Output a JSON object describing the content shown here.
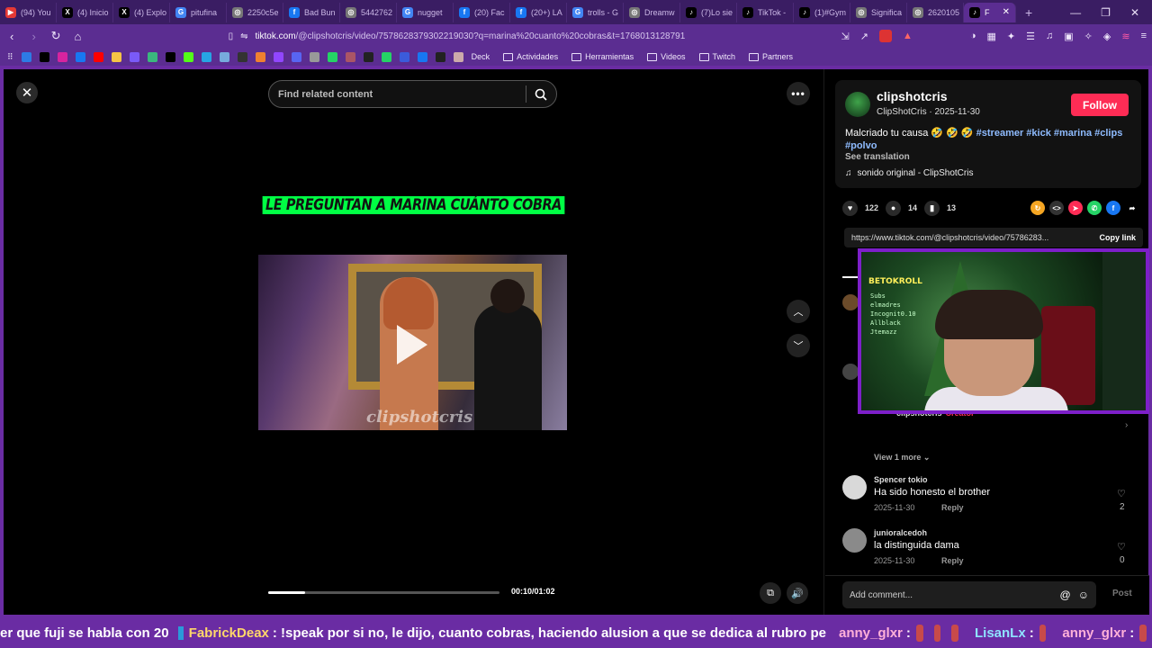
{
  "browser": {
    "tabs": [
      {
        "label": "(94) You",
        "color": "#e53935",
        "glyph": "▶"
      },
      {
        "label": "(4) Inicio",
        "color": "#000000",
        "glyph": "X"
      },
      {
        "label": "(4) Explo",
        "color": "#000000",
        "glyph": "X"
      },
      {
        "label": "pitufina",
        "color": "#4285f4",
        "glyph": "G"
      },
      {
        "label": "2250c5e",
        "color": "#777777",
        "glyph": "◎"
      },
      {
        "label": "Bad Bun",
        "color": "#1877f2",
        "glyph": "f"
      },
      {
        "label": "5442762",
        "color": "#777777",
        "glyph": "◎"
      },
      {
        "label": "nugget",
        "color": "#4285f4",
        "glyph": "G"
      },
      {
        "label": "(20) Fac",
        "color": "#1877f2",
        "glyph": "f"
      },
      {
        "label": "(20+) LA",
        "color": "#1877f2",
        "glyph": "f"
      },
      {
        "label": "trolls - G",
        "color": "#4285f4",
        "glyph": "G"
      },
      {
        "label": "Dreamw",
        "color": "#777777",
        "glyph": "◎"
      },
      {
        "label": "(7)Lo sie",
        "color": "#000000",
        "glyph": "♪"
      },
      {
        "label": "TikTok -",
        "color": "#000000",
        "glyph": "♪"
      },
      {
        "label": "(1)#Gym",
        "color": "#000000",
        "glyph": "♪"
      },
      {
        "label": "Significa",
        "color": "#777777",
        "glyph": "◎"
      },
      {
        "label": "2620105",
        "color": "#777777",
        "glyph": "◎"
      }
    ],
    "active_tab": {
      "label": "F",
      "glyph": "♪"
    },
    "new_tab": "+",
    "url_host": "tiktok.com",
    "url_rest": "/@clipshotcris/video/7578628379302219030?q=marina%20cuanto%20cobras&t=1768013128791",
    "bookmarks_folders": [
      "Deck",
      "Actividades",
      "Herramientas",
      "Videos",
      "Twitch",
      "Partners"
    ]
  },
  "video": {
    "search_placeholder": "Find related content",
    "caption": "LE PREGUNTAN A MARINA CUÁNTO COBRA",
    "watermark": "clipshotcris",
    "time": "00:10/01:02",
    "progress": 0.16
  },
  "post": {
    "username": "clipshotcris",
    "meta": "ClipShotCris · 2025-11-30",
    "follow_label": "Follow",
    "text": "Malcriado tu causa 🤣 🤣 🤣",
    "tags": "#streamer #kick #marina #clips",
    "tags2": "#polvo",
    "see_translation": "See translation",
    "sound": "sonido original - ClipShotCris",
    "likes": "122",
    "comments": "14",
    "saves": "13",
    "link": "https://www.tiktok.com/@clipshotcris/video/75786283...",
    "copy_link": "Copy link"
  },
  "comments": {
    "hidden_reply_author": "clipshotcris",
    "hidden_reply_badge": "Creator",
    "view_more": "View 1 more",
    "items": [
      {
        "name": "Spencer tokio",
        "text": "Ha sido honesto el brother",
        "date": "2025-11-30",
        "reply": "Reply",
        "likes": "2",
        "avatar": "#d9d9d9"
      },
      {
        "name": "junioralcedoh",
        "text": "la distinguida dama",
        "date": "2025-11-30",
        "reply": "Reply",
        "likes": "0",
        "avatar": "#8a8a8a"
      }
    ],
    "add_placeholder": "Add comment...",
    "post_label": "Post"
  },
  "webcam": {
    "sign": "BETOKROLL",
    "names": [
      "Subs",
      "elmadres",
      "Incognit0.10",
      "Allblack",
      "Jtemazz"
    ]
  },
  "chat": {
    "lead": "er que fuji se habla con 20",
    "user1": "FabrickDeax",
    "msg1": ": !speak por si no, le dijo, cuanto cobras, haciendo alusion a que se dedica al rubro pe",
    "user2": "anny_glxr",
    "sep": ":",
    "user3": "LisanLx",
    "user4": "anny_glxr"
  },
  "colors": {
    "accent_purple": "#6a2ca3",
    "follow_red": "#fe2c55",
    "caption_green": "#00ff44",
    "tag_blue": "#8fbcff"
  }
}
